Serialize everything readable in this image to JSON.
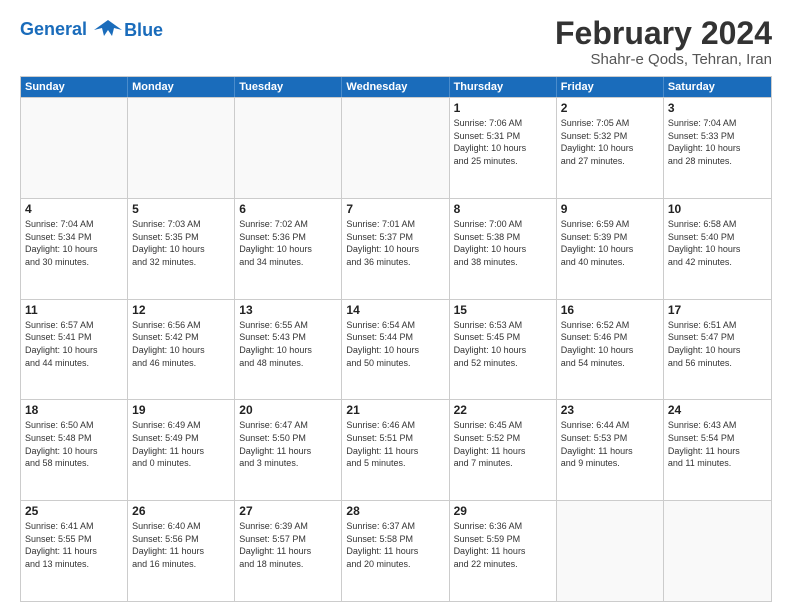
{
  "logo": {
    "line1": "General",
    "line2": "Blue"
  },
  "title": "February 2024",
  "location": "Shahr-e Qods, Tehran, Iran",
  "weekdays": [
    "Sunday",
    "Monday",
    "Tuesday",
    "Wednesday",
    "Thursday",
    "Friday",
    "Saturday"
  ],
  "rows": [
    [
      {
        "day": "",
        "info": ""
      },
      {
        "day": "",
        "info": ""
      },
      {
        "day": "",
        "info": ""
      },
      {
        "day": "",
        "info": ""
      },
      {
        "day": "1",
        "info": "Sunrise: 7:06 AM\nSunset: 5:31 PM\nDaylight: 10 hours\nand 25 minutes."
      },
      {
        "day": "2",
        "info": "Sunrise: 7:05 AM\nSunset: 5:32 PM\nDaylight: 10 hours\nand 27 minutes."
      },
      {
        "day": "3",
        "info": "Sunrise: 7:04 AM\nSunset: 5:33 PM\nDaylight: 10 hours\nand 28 minutes."
      }
    ],
    [
      {
        "day": "4",
        "info": "Sunrise: 7:04 AM\nSunset: 5:34 PM\nDaylight: 10 hours\nand 30 minutes."
      },
      {
        "day": "5",
        "info": "Sunrise: 7:03 AM\nSunset: 5:35 PM\nDaylight: 10 hours\nand 32 minutes."
      },
      {
        "day": "6",
        "info": "Sunrise: 7:02 AM\nSunset: 5:36 PM\nDaylight: 10 hours\nand 34 minutes."
      },
      {
        "day": "7",
        "info": "Sunrise: 7:01 AM\nSunset: 5:37 PM\nDaylight: 10 hours\nand 36 minutes."
      },
      {
        "day": "8",
        "info": "Sunrise: 7:00 AM\nSunset: 5:38 PM\nDaylight: 10 hours\nand 38 minutes."
      },
      {
        "day": "9",
        "info": "Sunrise: 6:59 AM\nSunset: 5:39 PM\nDaylight: 10 hours\nand 40 minutes."
      },
      {
        "day": "10",
        "info": "Sunrise: 6:58 AM\nSunset: 5:40 PM\nDaylight: 10 hours\nand 42 minutes."
      }
    ],
    [
      {
        "day": "11",
        "info": "Sunrise: 6:57 AM\nSunset: 5:41 PM\nDaylight: 10 hours\nand 44 minutes."
      },
      {
        "day": "12",
        "info": "Sunrise: 6:56 AM\nSunset: 5:42 PM\nDaylight: 10 hours\nand 46 minutes."
      },
      {
        "day": "13",
        "info": "Sunrise: 6:55 AM\nSunset: 5:43 PM\nDaylight: 10 hours\nand 48 minutes."
      },
      {
        "day": "14",
        "info": "Sunrise: 6:54 AM\nSunset: 5:44 PM\nDaylight: 10 hours\nand 50 minutes."
      },
      {
        "day": "15",
        "info": "Sunrise: 6:53 AM\nSunset: 5:45 PM\nDaylight: 10 hours\nand 52 minutes."
      },
      {
        "day": "16",
        "info": "Sunrise: 6:52 AM\nSunset: 5:46 PM\nDaylight: 10 hours\nand 54 minutes."
      },
      {
        "day": "17",
        "info": "Sunrise: 6:51 AM\nSunset: 5:47 PM\nDaylight: 10 hours\nand 56 minutes."
      }
    ],
    [
      {
        "day": "18",
        "info": "Sunrise: 6:50 AM\nSunset: 5:48 PM\nDaylight: 10 hours\nand 58 minutes."
      },
      {
        "day": "19",
        "info": "Sunrise: 6:49 AM\nSunset: 5:49 PM\nDaylight: 11 hours\nand 0 minutes."
      },
      {
        "day": "20",
        "info": "Sunrise: 6:47 AM\nSunset: 5:50 PM\nDaylight: 11 hours\nand 3 minutes."
      },
      {
        "day": "21",
        "info": "Sunrise: 6:46 AM\nSunset: 5:51 PM\nDaylight: 11 hours\nand 5 minutes."
      },
      {
        "day": "22",
        "info": "Sunrise: 6:45 AM\nSunset: 5:52 PM\nDaylight: 11 hours\nand 7 minutes."
      },
      {
        "day": "23",
        "info": "Sunrise: 6:44 AM\nSunset: 5:53 PM\nDaylight: 11 hours\nand 9 minutes."
      },
      {
        "day": "24",
        "info": "Sunrise: 6:43 AM\nSunset: 5:54 PM\nDaylight: 11 hours\nand 11 minutes."
      }
    ],
    [
      {
        "day": "25",
        "info": "Sunrise: 6:41 AM\nSunset: 5:55 PM\nDaylight: 11 hours\nand 13 minutes."
      },
      {
        "day": "26",
        "info": "Sunrise: 6:40 AM\nSunset: 5:56 PM\nDaylight: 11 hours\nand 16 minutes."
      },
      {
        "day": "27",
        "info": "Sunrise: 6:39 AM\nSunset: 5:57 PM\nDaylight: 11 hours\nand 18 minutes."
      },
      {
        "day": "28",
        "info": "Sunrise: 6:37 AM\nSunset: 5:58 PM\nDaylight: 11 hours\nand 20 minutes."
      },
      {
        "day": "29",
        "info": "Sunrise: 6:36 AM\nSunset: 5:59 PM\nDaylight: 11 hours\nand 22 minutes."
      },
      {
        "day": "",
        "info": ""
      },
      {
        "day": "",
        "info": ""
      }
    ]
  ]
}
